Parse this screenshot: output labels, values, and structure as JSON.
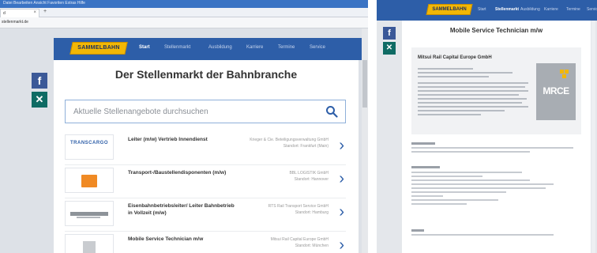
{
  "browser": {
    "menubar_text": "Datei  Bearbeiten  Ansicht  Favoriten  Extras  Hilfe",
    "tab_label": "d",
    "url": "stellenmarkt.de"
  },
  "site": {
    "logo_text": "SAMMELBAHN",
    "nav_items": [
      "Start",
      "Stellenmarkt",
      "Ausbildung",
      "Karriere",
      "Termine",
      "Service"
    ]
  },
  "page": {
    "heading": "Der Stellenmarkt der Bahnbranche",
    "search_placeholder": "Aktuelle Stellenangebote durchsuchen"
  },
  "jobs": [
    {
      "title": "Leiter (m/w) Vertrieb Innendienst",
      "company": "Krieger & Cie. Beteiligungsverwaltung GmbH",
      "location": "Standort: Frankfurt (Main)",
      "logo_text": "TRANSCARGO"
    },
    {
      "title": "Transport-/Baustellendisponenten (m/w)",
      "company": "BBL LOGISTIK GmbH",
      "location": "Standort: Hannover",
      "logo_text": ""
    },
    {
      "title": "Eisenbahnbetriebsleiter/ Leiter Bahnbetrieb in Vollzeit (m/w)",
      "company": "RTS Rail Transport Service GmbH",
      "location": "Standort: Hamburg",
      "logo_text": ""
    },
    {
      "title": "Mobile Service Technician m/w",
      "company": "Mitsui Rail Capital Europe GmbH",
      "location": "Standort: München",
      "logo_text": ""
    }
  ],
  "detail": {
    "title": "Mobile Service Technician m/w",
    "company": "Mitsui Rail Capital Europe GmbH",
    "company_logo": "MRCE"
  },
  "colors": {
    "brand_blue": "#2d5ea8",
    "logo_yellow": "#f2b705",
    "facebook": "#3b5998",
    "xing": "#0f6b64"
  }
}
